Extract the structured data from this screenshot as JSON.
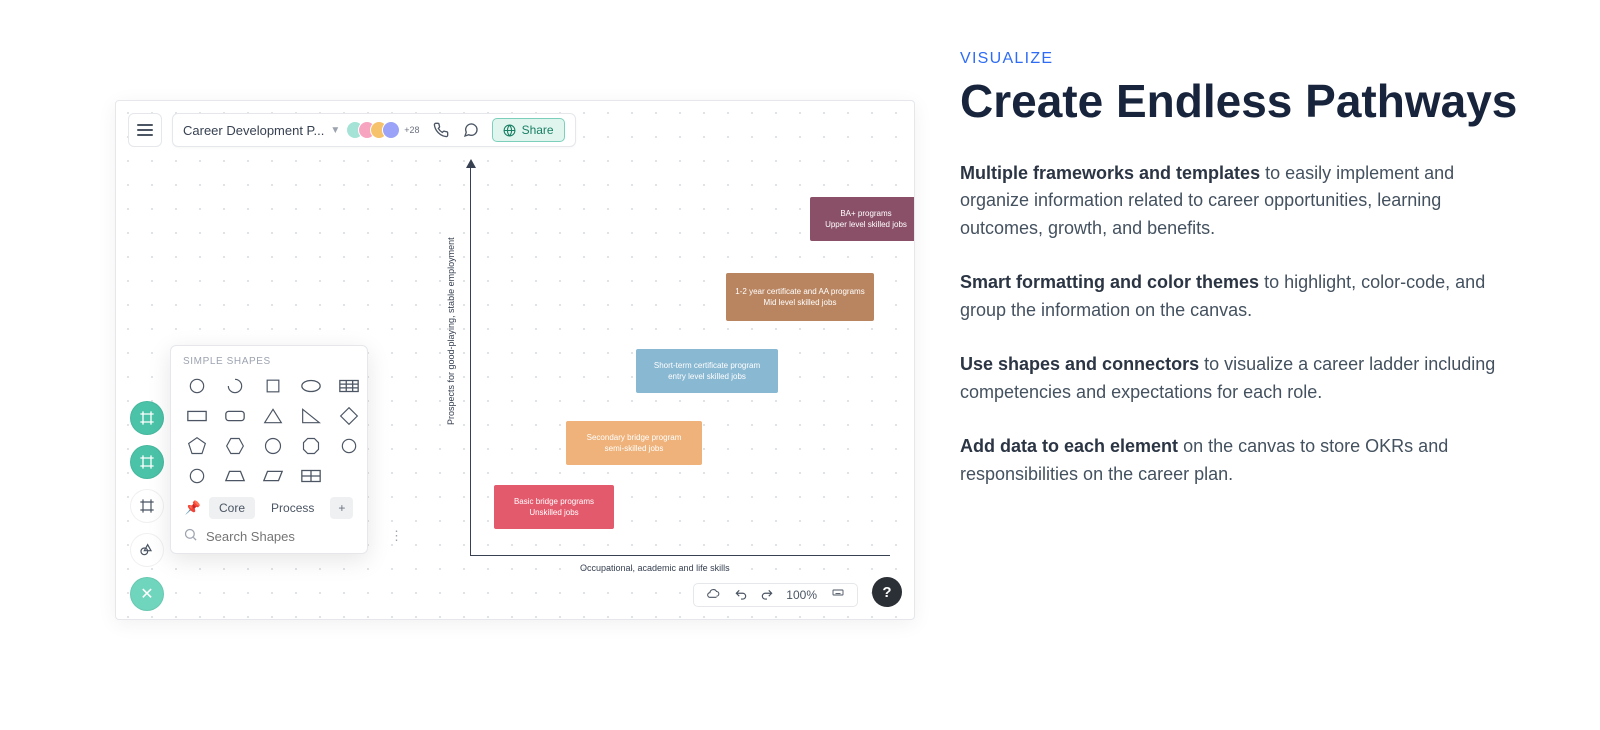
{
  "toolbar": {
    "doc_title": "Career Development P...",
    "share_label": "Share",
    "avatar_more": "+28"
  },
  "popover": {
    "title": "SIMPLE SHAPES",
    "tabs": {
      "core": "Core",
      "process": "Process"
    },
    "search_placeholder": "Search Shapes"
  },
  "chart": {
    "y_label": "Prospects for good-playing, stable employment",
    "x_label": "Occupational, academic and life skills",
    "boxes": [
      {
        "l1": "Basic bridge programs",
        "l2": "Unskilled jobs"
      },
      {
        "l1": "Secondary bridge program",
        "l2": "semi-skilled jobs"
      },
      {
        "l1": "Short-term certificate program",
        "l2": "entry level skilled jobs"
      },
      {
        "l1": "1-2 year certificate and AA programs",
        "l2": "Mid level skilled jobs"
      },
      {
        "l1": "BA+ programs",
        "l2": "Upper level skilled jobs"
      }
    ]
  },
  "status": {
    "zoom": "100%"
  },
  "marketing": {
    "eyebrow": "VISUALIZE",
    "headline": "Create Endless Pathways",
    "p1_bold": "Multiple frameworks and templates",
    "p1_rest": " to easily implement and organize information related to career opportunities, learning outcomes, growth, and benefits.",
    "p2_bold": "Smart formatting and color themes",
    "p2_rest": " to highlight, color-code, and group the information on the canvas.",
    "p3_bold": "Use shapes and connectors",
    "p3_rest": " to visualize a career ladder including competencies and expectations for each role.",
    "p4_bold": "Add data to each element",
    "p4_rest": " on the canvas to store OKRs and responsibilities on the career plan."
  },
  "colors": {
    "box_red": "#e45a6d",
    "box_orange": "#eeb27a",
    "box_blue": "#89b8d2",
    "box_brown": "#b98560",
    "box_purple": "#8a5068"
  }
}
